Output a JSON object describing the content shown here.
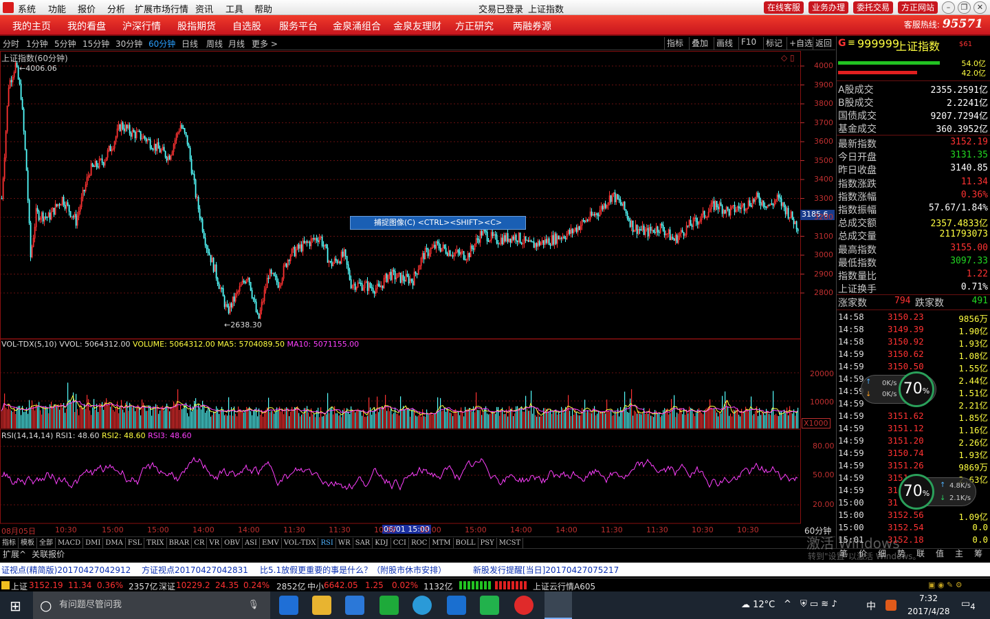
{
  "titlebar": {
    "menu": [
      "系统",
      "功能",
      "报价",
      "分析",
      "扩展市场行情",
      "资讯",
      "工具",
      "帮助"
    ],
    "center": [
      "交易已登录",
      "上证指数"
    ],
    "buttons": [
      "在线客服",
      "业务办理",
      "委托交易",
      "方正网站"
    ]
  },
  "navbar": {
    "items": [
      "我的主页",
      "我的看盘",
      "沪深行情",
      "股指期货",
      "自选股",
      "服务平台",
      "金泉涌组合",
      "金泉友理财",
      "方正研究",
      "两融券源"
    ],
    "hotline_label": "客服热线:",
    "hotline_number": "95571"
  },
  "periods": {
    "items": [
      "分时",
      "1分钟",
      "5分钟",
      "15分钟",
      "30分钟",
      "60分钟",
      "日线",
      "周线",
      "月线",
      "更多 >"
    ],
    "active": "60分钟"
  },
  "toolbar": [
    "指标",
    "叠加",
    "画线",
    "F10",
    "标记",
    "+自选",
    "返回"
  ],
  "chart": {
    "title": "上证指数(60分钟)",
    "high_mark": "4006.06",
    "low_mark": "2638.30",
    "price_tag": "3185.6",
    "capture_label": "捕捉图像(C)   <CTRL><SHIFT><C>",
    "price_axis": [
      "4000",
      "3900",
      "3800",
      "3700",
      "3600",
      "3500",
      "3400",
      "3300",
      "3200",
      "3100",
      "3000",
      "2900",
      "2800"
    ],
    "vol_header": {
      "name": "VOL-TDX(5,10)",
      "vvol": "VVOL: 5064312.00",
      "volume": "VOLUME: 5064312.00",
      "ma5": "MA5: 5704089.50",
      "ma10": "MA10: 5071155.00"
    },
    "vol_axis": [
      "20000",
      "10000"
    ],
    "vol_unit": "X1000",
    "rsi_header": {
      "name": "RSI(14,14,14)",
      "rsi1": "RSI1: 48.60",
      "rsi2": "RSI2: 48.60",
      "rsi3": "RSI3: 48.60"
    },
    "rsi_axis": [
      "80.00",
      "50.00",
      "20.00"
    ],
    "time_axis": [
      "08月05日",
      "10:30",
      "15:00",
      "15:00",
      "14:00",
      "14:00",
      "11:30",
      "11:30",
      "10:30",
      "15:00",
      "15:00",
      "14:00",
      "14:00",
      "11:30",
      "11:30",
      "10:30",
      "10:30"
    ],
    "cursor_time": "06/01 15:00",
    "period_label": "60分钟"
  },
  "indicator_tabs": [
    "指标",
    "模板",
    "全部",
    "MACD",
    "DMI",
    "DMA",
    "FSL",
    "TRIX",
    "BRAR",
    "CR",
    "VR",
    "OBV",
    "ASI",
    "EMV",
    "VOL-TDX",
    "RSI",
    "WR",
    "SAR",
    "KDJ",
    "CCI",
    "ROC",
    "MTM",
    "BOLL",
    "PSY",
    "MCST"
  ],
  "indicator_active": "RSI",
  "expand_bar": [
    "扩展^",
    "关联报价"
  ],
  "side": {
    "code": "999999",
    "name": "上证指数",
    "badge": "$61",
    "bar_values": [
      "54.0亿",
      "42.0亿"
    ],
    "turnover": [
      {
        "k": "A股成交",
        "v": "2355.2591亿"
      },
      {
        "k": "B股成交",
        "v": "2.2241亿"
      },
      {
        "k": "国债成交",
        "v": "9207.7294亿"
      },
      {
        "k": "基金成交",
        "v": "360.3952亿"
      }
    ],
    "quote": [
      {
        "k": "最新指数",
        "v": "3152.19",
        "c": "red"
      },
      {
        "k": "今日开盘",
        "v": "3131.35",
        "c": "grn"
      },
      {
        "k": "昨日收盘",
        "v": "3140.85",
        "c": "wht"
      },
      {
        "k": "指数涨跌",
        "v": "11.34",
        "c": "red"
      },
      {
        "k": "指数涨幅",
        "v": "0.36%",
        "c": "red"
      },
      {
        "k": "指数振幅",
        "v": "57.67/1.84%",
        "c": "wht"
      },
      {
        "k": "总成交额",
        "v": "2357.4833亿",
        "c": "yel"
      },
      {
        "k": "总成交量",
        "v": "211793073",
        "c": "yel"
      },
      {
        "k": "最高指数",
        "v": "3155.00",
        "c": "red"
      },
      {
        "k": "最低指数",
        "v": "3097.33",
        "c": "grn"
      },
      {
        "k": "指数量比",
        "v": "1.22",
        "c": "red"
      },
      {
        "k": "上证换手",
        "v": "0.71%",
        "c": "wht"
      }
    ],
    "breadth": {
      "up_label": "涨家数",
      "up": "794",
      "down_label": "跌家数",
      "down": "491"
    },
    "ticks": [
      {
        "t": "14:58",
        "p": "3150.23",
        "q": "9856万"
      },
      {
        "t": "14:58",
        "p": "3149.39",
        "q": "1.90亿"
      },
      {
        "t": "14:58",
        "p": "3150.92",
        "q": "1.93亿"
      },
      {
        "t": "14:59",
        "p": "3150.62",
        "q": "1.08亿"
      },
      {
        "t": "14:59",
        "p": "3150.50",
        "q": "1.55亿"
      },
      {
        "t": "14:59",
        "p": "",
        "q": "2.44亿"
      },
      {
        "t": "14:59",
        "p": "",
        "q": "1.51亿"
      },
      {
        "t": "14:59",
        "p": "",
        "q": "2.21亿"
      },
      {
        "t": "14:59",
        "p": "3151.62",
        "q": "1.85亿"
      },
      {
        "t": "14:59",
        "p": "3151.12",
        "q": "1.16亿"
      },
      {
        "t": "14:59",
        "p": "3151.20",
        "q": "2.26亿"
      },
      {
        "t": "14:59",
        "p": "3150.74",
        "q": "1.93亿"
      },
      {
        "t": "14:59",
        "p": "3151.26",
        "q": "9869万"
      },
      {
        "t": "14:59",
        "p": "3151",
        "q": "2.63亿"
      },
      {
        "t": "14:59",
        "p": "31",
        "q": ""
      },
      {
        "t": "15:00",
        "p": "31",
        "q": ""
      },
      {
        "t": "15:00",
        "p": "3152.56",
        "q": "1.09亿"
      },
      {
        "t": "15:00",
        "p": "3152.54",
        "q": "0.0"
      },
      {
        "t": "15:01",
        "p": "3152.18",
        "q": "0.0"
      }
    ],
    "bottom_tabs": [
      "笔",
      "价",
      "细",
      "势",
      "联",
      "值",
      "主",
      "筹"
    ],
    "watermark": "激活 Windows",
    "watermark2": "转到\"设置\"以激活 Windows。"
  },
  "speed_widgets": [
    {
      "up": "0K/s",
      "down": "0K/s",
      "pct": "70"
    },
    {
      "up": "4.8K/s",
      "down": "2.1K/s",
      "pct": "70"
    }
  ],
  "news": [
    "证视点(精简版)20170427042912",
    "方证视点20170427042831",
    "比5.1放假更重要的事是什么？（附股市休市安排）",
    "新股发行提醒[当日]20170427075217"
  ],
  "status": {
    "sh_label": "上证",
    "sh_val": "3152.19",
    "sh_chg": "11.34",
    "sh_pct": "0.36%",
    "sh_amt": "2357亿",
    "sz_label": "深证",
    "sz_val": "10229.2",
    "sz_chg": "24.35",
    "sz_pct": "0.24%",
    "sz_amt": "2852亿",
    "zx_label": "中小",
    "zx_val": "6642.05",
    "zx_chg": "1.25",
    "zx_pct": "0.02%",
    "zx_amt": "1132亿",
    "server": "上证云行情A605"
  },
  "taskbar": {
    "search_placeholder": "有问题尽管问我",
    "temp": "12°C",
    "ime": "中",
    "time": "7:32",
    "date": "2017/4/28",
    "notif": "4"
  },
  "colors": {
    "up": "#ff3232",
    "down": "#54ffff",
    "accent": "#c8161e",
    "rsi": "#ff40ff"
  }
}
